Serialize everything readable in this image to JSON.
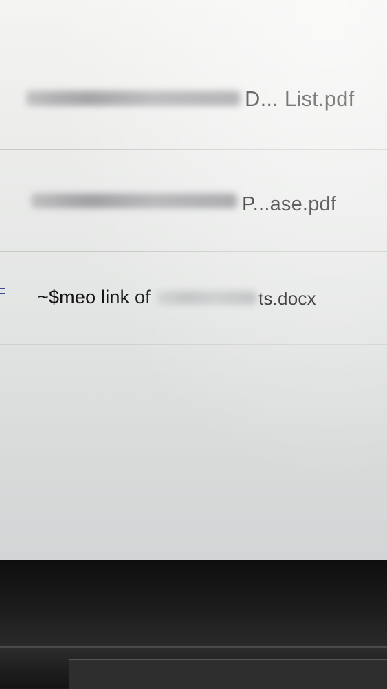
{
  "files": [
    {
      "name": "D... List.pdf"
    },
    {
      "name": "P...ase.pdf"
    },
    {
      "name": "~$meo link of",
      "suffix": "ts.docx"
    }
  ]
}
